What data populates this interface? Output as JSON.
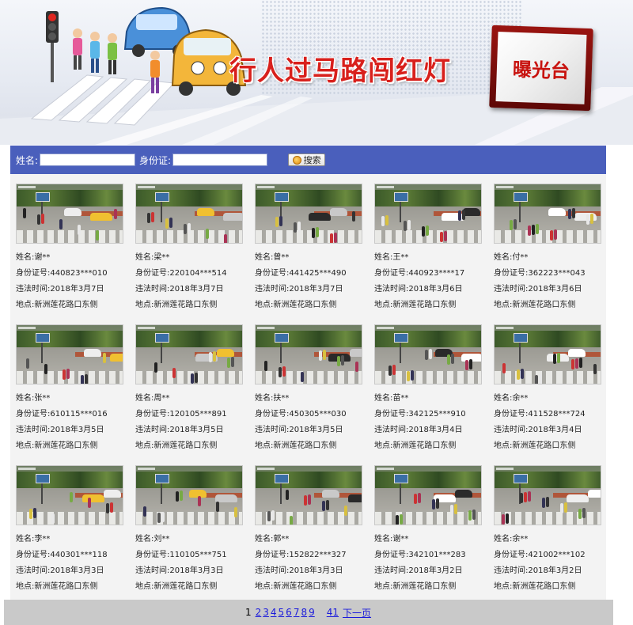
{
  "banner": {
    "title": "行人过马路闯红灯",
    "stamp_text": "曝光台"
  },
  "search": {
    "name_label": "姓名:",
    "id_label": "身份证:",
    "name_value": "",
    "id_value": "",
    "button_label": "搜索"
  },
  "labels": {
    "name": "姓名:",
    "id": "身份证号:",
    "time": "违法时间:",
    "place": "地点:"
  },
  "records": [
    {
      "name": "谢**",
      "id": "440823***010",
      "time": "2018年3月7日",
      "place": "新洲莲花路口东侧"
    },
    {
      "name": "梁**",
      "id": "220104***514",
      "time": "2018年3月7日",
      "place": "新洲莲花路口东侧"
    },
    {
      "name": "曾**",
      "id": "441425***490",
      "time": "2018年3月7日",
      "place": "新洲莲花路口东侧"
    },
    {
      "name": "王**",
      "id": "440923****17",
      "time": "2018年3月6日",
      "place": "新洲莲花路口东侧"
    },
    {
      "name": "付**",
      "id": "362223***043",
      "time": "2018年3月6日",
      "place": "新洲莲花路口东侧"
    },
    {
      "name": "张**",
      "id": "610115***016",
      "time": "2018年3月5日",
      "place": "新洲莲花路口东侧"
    },
    {
      "name": "周**",
      "id": "120105***891",
      "time": "2018年3月5日",
      "place": "新洲莲花路口东侧"
    },
    {
      "name": "扶**",
      "id": "450305***030",
      "time": "2018年3月5日",
      "place": "新洲莲花路口东侧"
    },
    {
      "name": "苗**",
      "id": "342125***910",
      "time": "2018年3月4日",
      "place": "新洲莲花路口东侧"
    },
    {
      "name": "余**",
      "id": "411528***724",
      "time": "2018年3月4日",
      "place": "新洲莲花路口东侧"
    },
    {
      "name": "李**",
      "id": "440301***118",
      "time": "2018年3月3日",
      "place": "新洲莲花路口东侧"
    },
    {
      "name": "刘**",
      "id": "110105***751",
      "time": "2018年3月3日",
      "place": "新洲莲花路口东侧"
    },
    {
      "name": "郭**",
      "id": "152822***327",
      "time": "2018年3月3日",
      "place": "新洲莲花路口东侧"
    },
    {
      "name": "谢**",
      "id": "342101***283",
      "time": "2018年3月2日",
      "place": "新洲莲花路口东侧"
    },
    {
      "name": "余**",
      "id": "421002***102",
      "time": "2018年3月2日",
      "place": "新洲莲花路口东侧"
    }
  ],
  "pagination": {
    "current": "1",
    "pages": [
      "2",
      "3",
      "4",
      "5",
      "6",
      "7",
      "8",
      "9"
    ],
    "last": "41",
    "next_label": "下一页"
  },
  "colors": {
    "search_bar": "#4a5fbc",
    "title_red": "#d8201c",
    "link_blue": "#1a1adb"
  }
}
